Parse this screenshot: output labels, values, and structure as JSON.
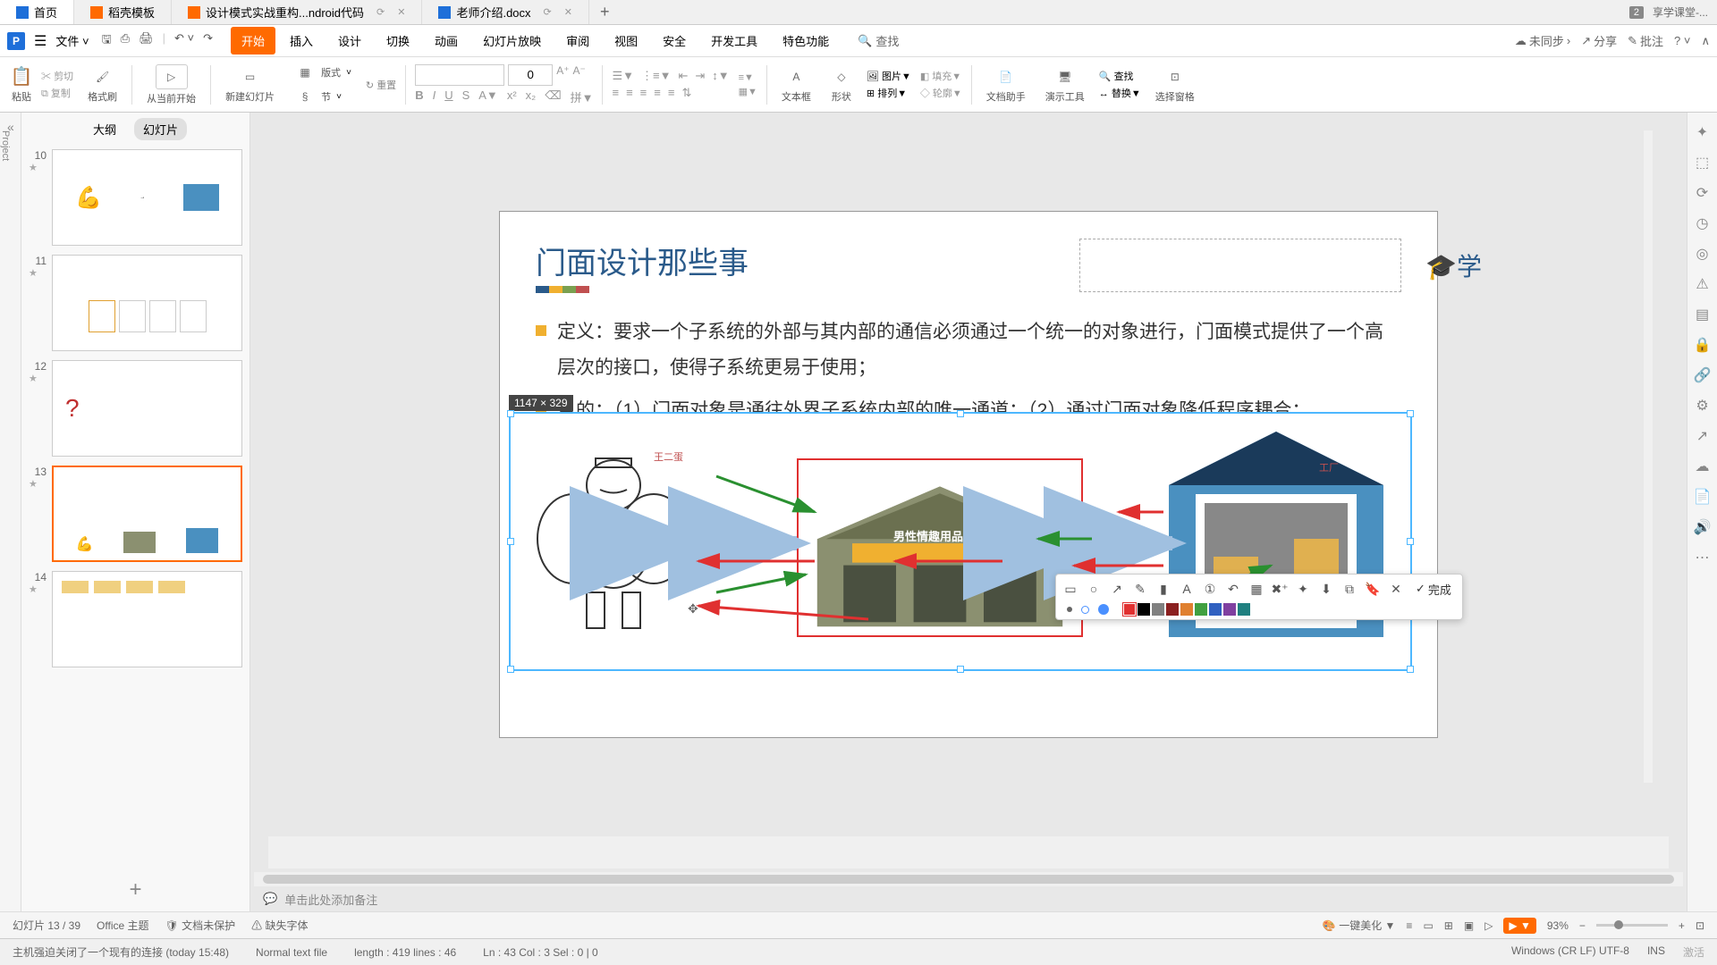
{
  "tabs": {
    "t0": {
      "label": "首页",
      "icon_color": "#1e6fd9"
    },
    "t1": {
      "label": "稻壳模板",
      "icon_color": "#ff6a00"
    },
    "t2": {
      "label": "设计模式实战重构...ndroid代码",
      "icon_color": "#ff6a00"
    },
    "t3": {
      "label": "老师介绍.docx",
      "icon_color": "#1e6fd9"
    },
    "badge": "2",
    "right_app": "享学课堂-..."
  },
  "menu": {
    "file": "文件",
    "items": {
      "m0": "开始",
      "m1": "插入",
      "m2": "设计",
      "m3": "切换",
      "m4": "动画",
      "m5": "幻灯片放映",
      "m6": "审阅",
      "m7": "视图",
      "m8": "安全",
      "m9": "开发工具",
      "m10": "特色功能"
    },
    "search": "查找",
    "right": {
      "sync": "未同步",
      "share": "分享",
      "comment": "批注"
    }
  },
  "ribbon": {
    "paste": "粘贴",
    "cut": "剪切",
    "copy": "复制",
    "format": "格式刷",
    "play": "从当前开始",
    "newslide": "新建幻灯片",
    "layout": "版式",
    "section": "节",
    "reset": "重置",
    "font_size": "0",
    "textbox": "文本框",
    "shape": "形状",
    "image": "图片",
    "arrange": "排列",
    "replace": "替换",
    "find": "查找",
    "assist": "文档助手",
    "present": "演示工具",
    "repl2": "替换",
    "select": "选择窗格"
  },
  "thumbnails": {
    "tab_outline": "大纲",
    "tab_slides": "幻灯片",
    "items": [
      {
        "num": "10"
      },
      {
        "num": "11"
      },
      {
        "num": "12"
      },
      {
        "num": "13"
      },
      {
        "num": "14"
      }
    ]
  },
  "slide": {
    "title": "门面设计那些事",
    "bullet1": "定义：要求一个子系统的外部与其内部的通信必须通过一个统一的对象进行，门面模式提供了一个高层次的接口，使得子系统更易于使用；",
    "bullet2": "目的：（1）门面对象是通往外界子系统内部的唯一通道；（2）通过门面对象降低程序耦合；",
    "dim_label": "1147 × 329",
    "label_person": "王二蛋",
    "label_company": "男性情趣用品公司",
    "label_factory": "工厂",
    "logo_right": "学"
  },
  "notes": {
    "placeholder": "单击此处添加备注"
  },
  "annotation": {
    "done": "完成"
  },
  "status1": {
    "slide_num": "幻灯片 13 / 39",
    "theme": "Office 主题",
    "unprotected": "文档未保护",
    "missing_font": "缺失字体",
    "beautify": "一键美化",
    "zoom": "93%"
  },
  "status2": {
    "conn": "主机强迫关闭了一个现有的连接 (today 15:48)",
    "mode": "Normal text file",
    "length": "length : 419   lines : 46",
    "pos": "Ln : 43   Col : 3   Sel : 0 | 0",
    "enc": "Windows (CR LF)   UTF-8",
    "ins": "INS",
    "activate": "激活"
  }
}
